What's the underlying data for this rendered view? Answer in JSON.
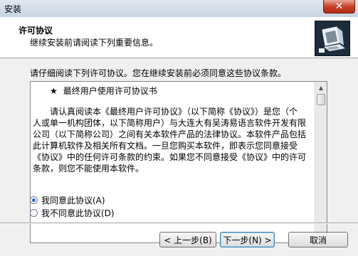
{
  "window": {
    "title": "安装",
    "close_label": "✕"
  },
  "header": {
    "title": "许可协议",
    "subtitle": "继续安装前请阅读下列重要信息。",
    "logo_icon": "installer-computer-icon"
  },
  "body": {
    "instruction": "请仔细阅读下列许可协议。您在继续安装前必须同意这些协议条款。",
    "license": {
      "star": "★",
      "title": "最终用户使用许可协议书",
      "paragraph_lines": [
        "请认真阅读本《最终用户许可协议》（以下简称《协议》）是您（个",
        "人或单一机构团体，以下简称用户）与大连大有吴涛易语言软件开发有限",
        "公司（以下简称公司）之间有关本软件产品的法律协议。本软件产品包括",
        "此计算机软件及相关所有文档。一旦您购买本软件，即表示您同意接受",
        "《协议》中的任何许可条款的约束。如果您不同意接受《协议》中的许可",
        "条款，则您不能使用本软件。"
      ]
    },
    "options": [
      {
        "label": "我同意此协议(A)",
        "checked": true
      },
      {
        "label": "我不同意此协议(D)",
        "checked": false
      }
    ]
  },
  "buttons": {
    "back": "< 上一步(B)",
    "next": "下一步(N) >",
    "cancel": "取消"
  },
  "colors": {
    "accent": "#2b67c3",
    "close": "#c7422b"
  }
}
